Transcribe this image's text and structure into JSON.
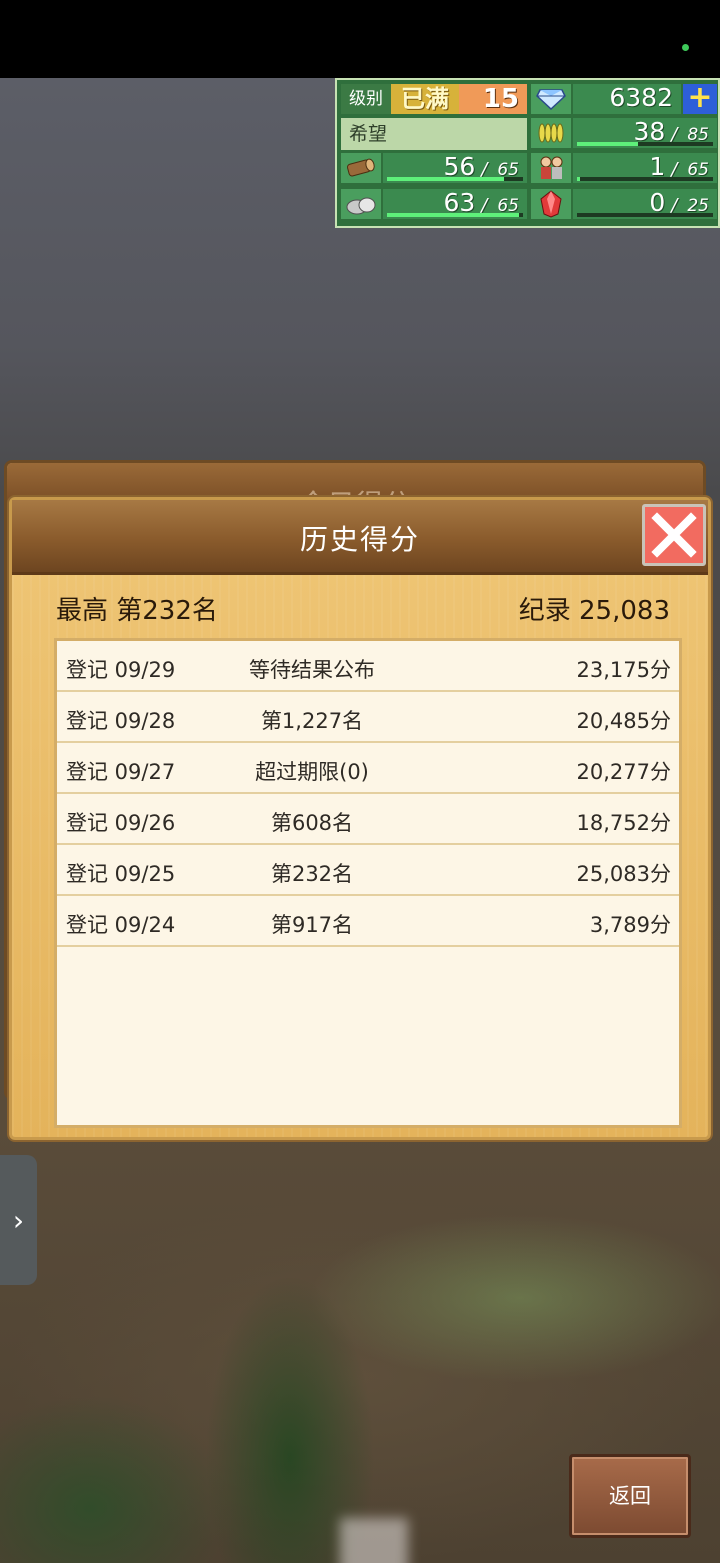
{
  "resources": {
    "level_label": "级别",
    "level_full": "已满",
    "level_value": "15",
    "gems": "6382",
    "hope_label": "希望",
    "hope_current": "38",
    "hope_max": "85",
    "wood_current": "56",
    "wood_max": "65",
    "people_current": "1",
    "people_max": "65",
    "ore_current": "63",
    "ore_max": "65",
    "crystal_current": "0",
    "crystal_max": "25",
    "hope_fill": 0.45,
    "wood_fill": 0.86,
    "ore_fill": 0.97,
    "people_fill": 0.02,
    "crystal_fill": 0
  },
  "background_dialog": {
    "title": "今日得分"
  },
  "dialog": {
    "title": "历史得分",
    "best_label": "最高 第232名",
    "record_label": "纪录 25,083",
    "rows": [
      {
        "date": "登记 09/29",
        "status": "等待结果公布",
        "score": "23,175分"
      },
      {
        "date": "登记 09/28",
        "status": "第1,227名",
        "score": "20,485分"
      },
      {
        "date": "登记 09/27",
        "status": "超过期限(0)",
        "score": "20,277分"
      },
      {
        "date": "登记 09/26",
        "status": "第608名",
        "score": "18,752分"
      },
      {
        "date": "登记 09/25",
        "status": "第232名",
        "score": "25,083分"
      },
      {
        "date": "登记 09/24",
        "status": "第917名",
        "score": "3,789分"
      }
    ]
  },
  "return_button": "返回",
  "side_handle_icon": "chevron-right-icon"
}
